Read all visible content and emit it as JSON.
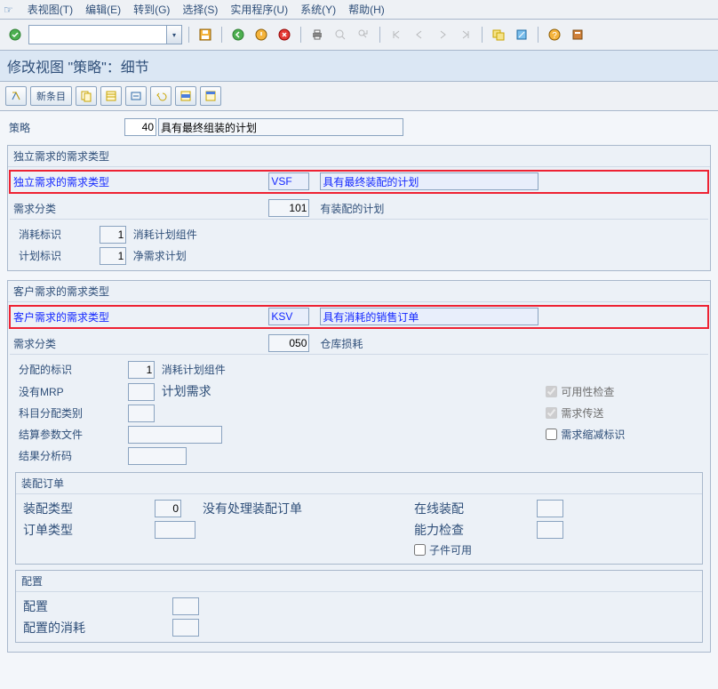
{
  "menu": {
    "indicator": "☞",
    "items": [
      "表视图(T)",
      "编辑(E)",
      "转到(G)",
      "选择(S)",
      "实用程序(U)",
      "系统(Y)",
      "帮助(H)"
    ]
  },
  "title": "修改视图 \"策略\"：细节",
  "appbar": {
    "new_entry": "新条目"
  },
  "icons": {
    "ok": "ok-icon",
    "save": "save-icon",
    "back": "back-icon",
    "exit": "exit-icon",
    "cancel": "cancel-icon",
    "print": "print-icon",
    "find": "find-icon",
    "findnext": "find-next-icon",
    "first": "first-icon",
    "prev": "prev-icon",
    "next": "next-icon",
    "last": "last-icon",
    "newsess": "new-session-icon",
    "shortcut": "shortcut-icon",
    "help": "help-icon",
    "layout": "layout-icon",
    "toggle": "toggle-icon",
    "copy": "copy-icon",
    "variant": "variant-icon",
    "edit": "edit-icon",
    "undo": "undo-icon",
    "deleterow": "delete-row-icon",
    "tableset": "table-settings-icon"
  },
  "header": {
    "strategy_label": "策略",
    "strategy_val": "40",
    "strategy_desc": "具有最终组装的计划"
  },
  "g1": {
    "title": "独立需求的需求类型",
    "r1_label": "独立需求的需求类型",
    "r1_code": "VSF",
    "r1_desc": "具有最终装配的计划",
    "r2_label": "需求分类",
    "r2_code": "101",
    "r2_desc": "有装配的计划",
    "r3_label": "消耗标识",
    "r3_code": "1",
    "r3_desc": "消耗计划组件",
    "r4_label": "计划标识",
    "r4_code": "1",
    "r4_desc": "净需求计划"
  },
  "g2": {
    "title": "客户需求的需求类型",
    "r1_label": "客户需求的需求类型",
    "r1_code": "KSV",
    "r1_desc": "具有消耗的销售订单",
    "r2_label": "需求分类",
    "r2_code": "050",
    "r2_desc": "仓库损耗",
    "r3_label": "分配的标识",
    "r3_code": "1",
    "r3_desc": "消耗计划组件",
    "r4_label": "没有MRP",
    "r4_desc": "计划需求",
    "r5_label": "科目分配类别",
    "r6_label": "结算参数文件",
    "r7_label": "结果分析码",
    "chk1": "可用性检查",
    "chk2": "需求传送",
    "chk3": "需求缩减标识"
  },
  "g3": {
    "title": "装配订单",
    "r1_label": "装配类型",
    "r1_code": "0",
    "r1_desc": "没有处理装配订单",
    "r2_label": "订单类型",
    "c1_label": "在线装配",
    "c2_label": "能力检查",
    "chk1": "子件可用"
  },
  "g4": {
    "title": "配置",
    "r1_label": "配置",
    "r2_label": "配置的消耗"
  }
}
